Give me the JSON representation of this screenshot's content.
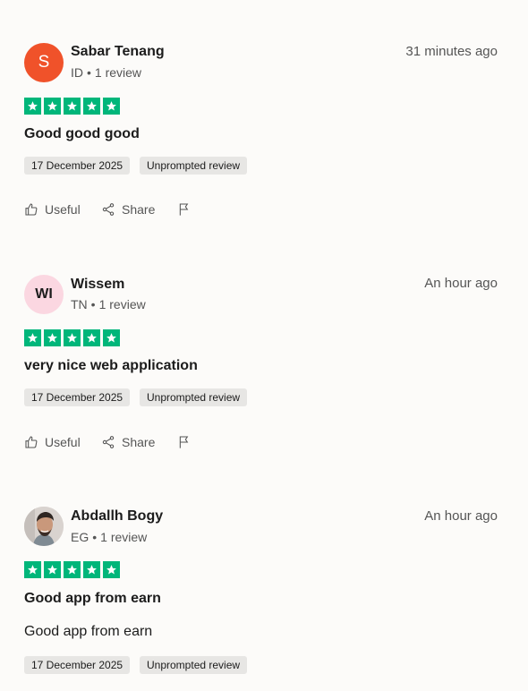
{
  "reviews": [
    {
      "name": "Sabar Tenang",
      "initials": "S",
      "country": "ID",
      "review_count": "1 review",
      "time": "31 minutes ago",
      "rating": 5,
      "title": "Good good good",
      "body": "",
      "date": "17 December 2025",
      "badge": "Unprompted review",
      "useful_label": "Useful",
      "share_label": "Share",
      "avatar_color": "#f0522a"
    },
    {
      "name": "Wissem",
      "initials": "WI",
      "country": "TN",
      "review_count": "1 review",
      "time": "An hour ago",
      "rating": 5,
      "title": "very nice web application",
      "body": "",
      "date": "17 December 2025",
      "badge": "Unprompted review",
      "useful_label": "Useful",
      "share_label": "Share",
      "avatar_color": "#fbd7e1"
    },
    {
      "name": "Abdallh Bogy",
      "initials": "",
      "country": "EG",
      "review_count": "1 review",
      "time": "An hour ago",
      "rating": 5,
      "title": "Good app from earn",
      "body": "Good app from earn",
      "date": "17 December 2025",
      "badge": "Unprompted review",
      "avatar_color": "#d9d3cf"
    }
  ],
  "colors": {
    "star_green": "#00b67a",
    "tag_bg": "#e7e6e4",
    "muted_text": "#555555"
  },
  "icons": {
    "useful": "thumbs-up-icon",
    "share": "share-icon",
    "report": "flag-icon"
  }
}
